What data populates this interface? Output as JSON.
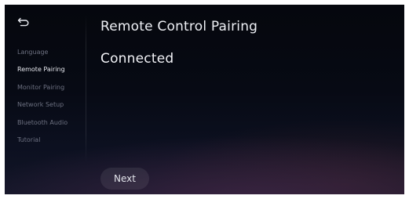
{
  "sidebar": {
    "back_icon": "back-arrow-icon",
    "items": [
      {
        "label": "Language",
        "active": false
      },
      {
        "label": "Remote Pairing",
        "active": true
      },
      {
        "label": "Monitor Pairing",
        "active": false
      },
      {
        "label": "Network Setup",
        "active": false
      },
      {
        "label": "Bluetooth Audio",
        "active": false
      },
      {
        "label": "Tutorial",
        "active": false
      }
    ]
  },
  "main": {
    "title": "Remote Control Pairing",
    "status": "Connected",
    "next_label": "Next"
  },
  "colors": {
    "background": "#070a14",
    "text_primary": "#eef0f5",
    "text_muted": "#6c7080",
    "button_bg": "#1f2230"
  }
}
